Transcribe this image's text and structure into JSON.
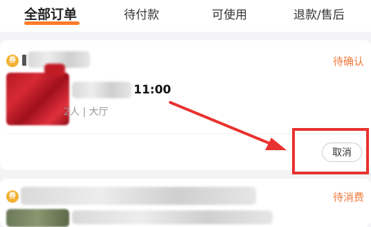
{
  "tabs": [
    {
      "label": "全部订单",
      "active": true
    },
    {
      "label": "待付款",
      "active": false
    },
    {
      "label": "可使用",
      "active": false
    },
    {
      "label": "退款/售后",
      "active": false
    }
  ],
  "orders": [
    {
      "shop_icon": "券",
      "status": "待确认",
      "time": "11:00",
      "meta": "2人 | 大厅",
      "action_label": "取消"
    },
    {
      "shop_icon": "券",
      "status": "待消费"
    }
  ],
  "colors": {
    "accent": "#ff7a2a",
    "status": "#f07a3c",
    "annotation": "#e8322f"
  }
}
